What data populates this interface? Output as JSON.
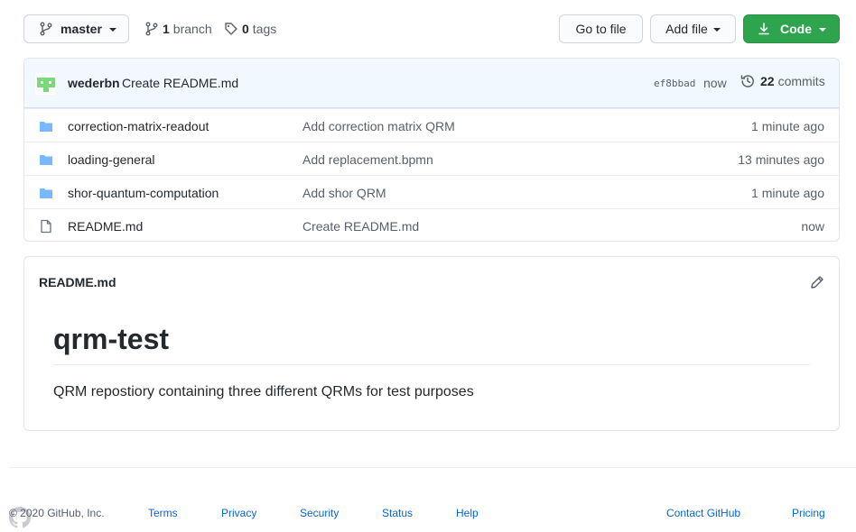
{
  "toolbar": {
    "branch_name": "master",
    "branch_count": "1",
    "branch_label": "branch",
    "tag_count": "0",
    "tag_label": "tags",
    "goto_file": "Go to file",
    "add_file": "Add file",
    "code": "Code"
  },
  "commit": {
    "author": "wederbn",
    "message": "Create README.md",
    "sha": "ef8bbad",
    "time": "now",
    "count": "22",
    "count_label": "commits"
  },
  "files": [
    {
      "name": "correction-matrix-readout",
      "type": "folder-icon",
      "message": "Add correction matrix QRM",
      "age": "1 minute ago"
    },
    {
      "name": "loading-general",
      "type": "folder-icon",
      "message": "Add replacement.bpmn",
      "age": "13 minutes ago"
    },
    {
      "name": "shor-quantum-computation",
      "type": "folder-icon",
      "message": "Add shor QRM",
      "age": "1 minute ago"
    },
    {
      "name": "README.md",
      "type": "file-icon",
      "message": "Create README.md",
      "age": "now"
    }
  ],
  "readme": {
    "header": "README.md",
    "title": "qrm-test",
    "body": "QRM repostiory containing three different QRMs for test purposes"
  },
  "footer": {
    "copyright": "© 2020 GitHub, Inc.",
    "links": [
      "Terms",
      "Privacy",
      "Security",
      "Status",
      "Help",
      "Contact GitHub",
      "Pricing"
    ]
  },
  "colors": {
    "accent_green": "#2ea44f",
    "link_blue": "#0366d6",
    "folder_blue": "#79b8ff",
    "commit_bar_bg": "#f1f8ff"
  }
}
